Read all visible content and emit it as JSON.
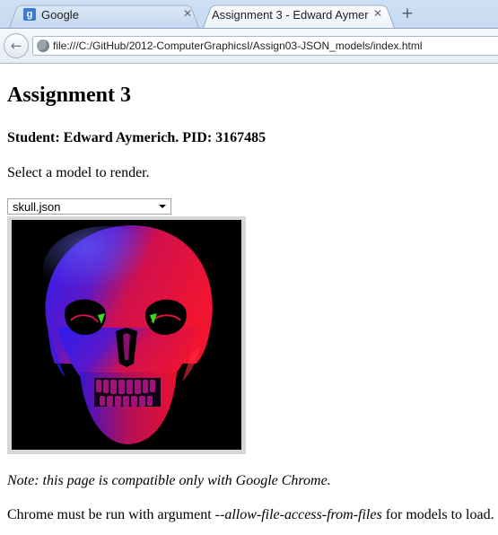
{
  "browser": {
    "tabs": [
      {
        "favicon": "g",
        "title": "Google",
        "active": false
      },
      {
        "title": "Assignment 3 - Edward Aymeri...",
        "active": true
      }
    ],
    "url": "file:///C:/GitHub/2012-ComputerGraphicsI/Assign03-JSON_models/index.html"
  },
  "page": {
    "heading": "Assignment 3",
    "student": "Student: Edward Aymerich. PID: 3167485",
    "select_prompt": "Select a model to render.",
    "model_select": {
      "selected": "skull.json"
    },
    "canvas": {
      "render": "skull-render"
    },
    "note": "Note: this page is compatible only with Google Chrome.",
    "requirement": {
      "before": "Chrome must be run with argument ",
      "arg": "--allow-file-access-from-files",
      "after": " for models to load."
    }
  },
  "colors": {
    "skull_red": "#e0103a",
    "skull_blue": "#2a1cf0",
    "eye_green": "#3fd81c"
  }
}
